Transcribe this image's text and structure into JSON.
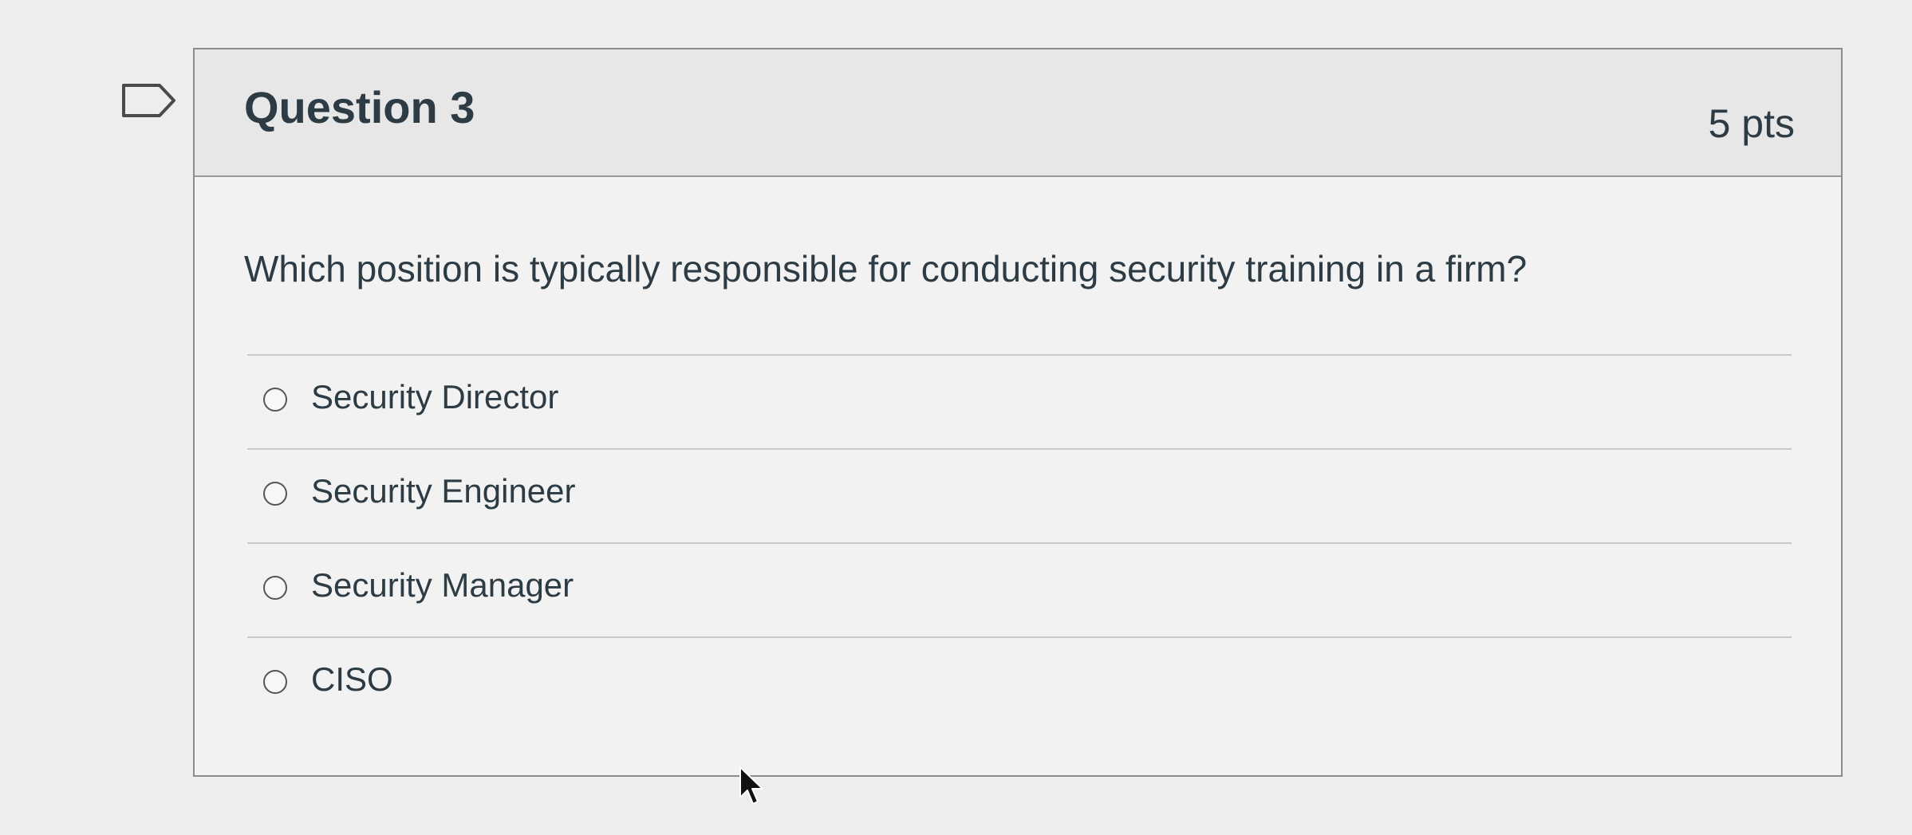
{
  "question": {
    "title": "Question 3",
    "points": "5 pts",
    "text": "Which position is typically responsible for conducting security training in a firm?",
    "answers": [
      {
        "label": "Security Director",
        "selected": false
      },
      {
        "label": "Security Engineer",
        "selected": false
      },
      {
        "label": "Security Manager",
        "selected": false
      },
      {
        "label": "CISO",
        "selected": false
      }
    ]
  },
  "icons": {
    "flag": "flag-question-icon",
    "cursor": "mouse-pointer-icon"
  },
  "colors": {
    "text": "#2d3b45",
    "header_bg": "#e7e7e7",
    "card_bg": "#f2f2f2",
    "border": "#8c8c8c"
  }
}
